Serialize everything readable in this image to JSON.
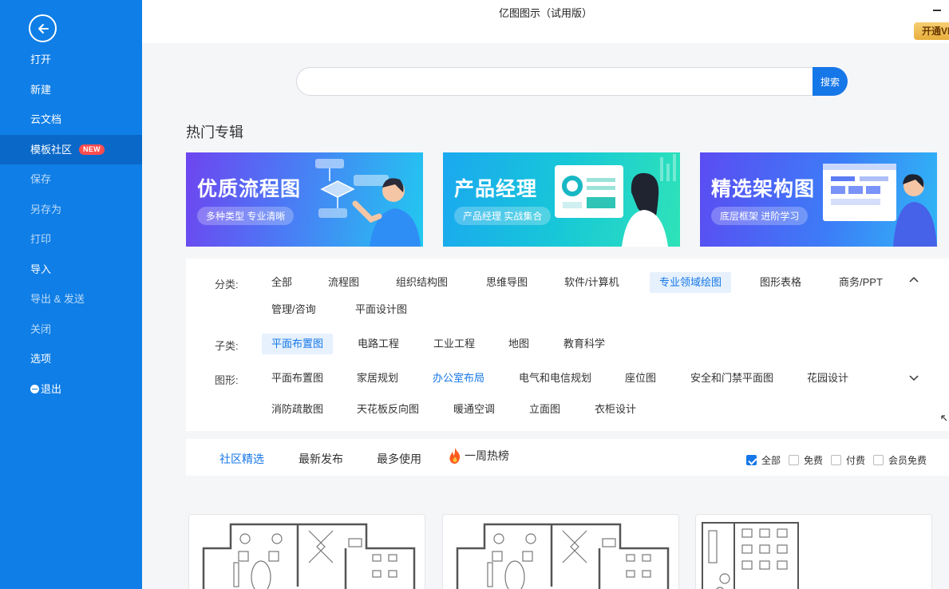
{
  "window": {
    "title": "亿图图示（试用版）",
    "vip_label": "开通VIP"
  },
  "sidebar": {
    "items": [
      {
        "label": "打开",
        "name": "sidebar-item-open",
        "state": "normal"
      },
      {
        "label": "新建",
        "name": "sidebar-item-new",
        "state": "normal"
      },
      {
        "label": "云文档",
        "name": "sidebar-item-cloud-docs",
        "state": "normal"
      },
      {
        "label": "模板社区",
        "name": "sidebar-item-template-community",
        "state": "active",
        "badge": "NEW"
      },
      {
        "label": "保存",
        "name": "sidebar-item-save",
        "state": "dim"
      },
      {
        "label": "另存为",
        "name": "sidebar-item-save-as",
        "state": "dim"
      },
      {
        "label": "打印",
        "name": "sidebar-item-print",
        "state": "dim"
      },
      {
        "label": "导入",
        "name": "sidebar-item-import",
        "state": "normal"
      },
      {
        "label": "导出 & 发送",
        "name": "sidebar-item-export-send",
        "state": "dim"
      },
      {
        "label": "关闭",
        "name": "sidebar-item-close",
        "state": "dim"
      },
      {
        "label": "选项",
        "name": "sidebar-item-options",
        "state": "normal"
      },
      {
        "label": "退出",
        "name": "sidebar-item-exit",
        "state": "normal"
      }
    ]
  },
  "search": {
    "value": "",
    "placeholder": "",
    "button_label": "搜索"
  },
  "hot": {
    "title": "热门专辑",
    "banners": [
      {
        "title": "优质流程图",
        "subtitle": "多种类型 专业清晰"
      },
      {
        "title": "产品经理",
        "subtitle": "产品经理 实战集合"
      },
      {
        "title": "精选架构图",
        "subtitle": "底层框架 进阶学习"
      }
    ]
  },
  "filters": {
    "category_label": "分类:",
    "categories": [
      "全部",
      "流程图",
      "组织结构图",
      "思维导图",
      "软件/计算机",
      "专业领域绘图",
      "图形表格",
      "商务/PPT",
      "管理/咨询",
      "平面设计图"
    ],
    "subcategory_label": "子类:",
    "subcategories": [
      "平面布置图",
      "电路工程",
      "工业工程",
      "地图",
      "教育科学"
    ],
    "shape_label": "图形:",
    "shapes": [
      "平面布置图",
      "家居规划",
      "办公室布局",
      "电气和电信规划",
      "座位图",
      "安全和门禁平面图",
      "花园设计",
      "消防疏散图",
      "天花板反向图",
      "暖通空调",
      "立面图",
      "衣柜设计"
    ]
  },
  "tabs": [
    "社区精选",
    "最新发布",
    "最多使用",
    "一周热榜"
  ],
  "price_filters": [
    {
      "label": "全部",
      "checked": true
    },
    {
      "label": "免费",
      "checked": false
    },
    {
      "label": "付费",
      "checked": false
    },
    {
      "label": "会员免费",
      "checked": false
    }
  ],
  "colors": {
    "sidebar": "#0f7ee6",
    "accent": "#1677e8",
    "active_item": "#0a68c8"
  },
  "icons": {
    "back": "back-arrow-icon",
    "collapse": "chevron-up-icon",
    "expand": "chevron-down-icon",
    "hot": "fire-icon",
    "exit": "exit-icon"
  }
}
